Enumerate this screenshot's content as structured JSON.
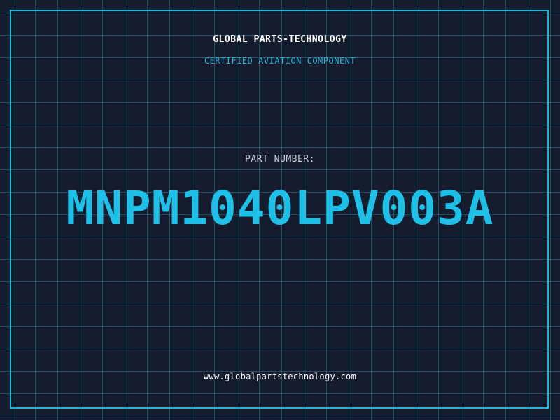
{
  "header": {
    "company_name": "GLOBAL PARTS-TECHNOLOGY",
    "tagline": "CERTIFIED AVIATION COMPONENT"
  },
  "part": {
    "label": "PART NUMBER:",
    "number": "MNPM1040LPV003A"
  },
  "footer": {
    "website": "www.globalpartstechnology.com"
  },
  "colors": {
    "background": "#141c2e",
    "grid": "#26789a",
    "accent": "#1fb4d8",
    "part_number": "#1ec0e8"
  }
}
